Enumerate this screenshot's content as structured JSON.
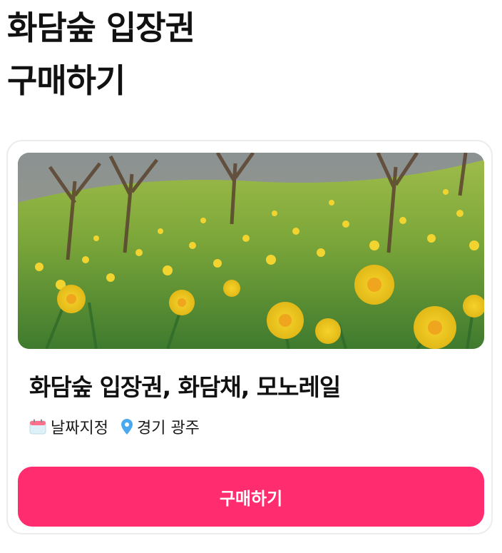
{
  "page": {
    "title": "화담숲 입장권\n구매하기"
  },
  "product": {
    "image_alt": "노란 수선화가 핀 화담숲 언덕",
    "title": "화담숲 입장권, 화담채, 모노레일",
    "date_label": "날짜지정",
    "date_icon": "calendar-icon",
    "location_label": "경기 광주",
    "location_icon": "location-pin-icon"
  },
  "actions": {
    "buy_label": "구매하기"
  },
  "colors": {
    "accent": "#ff2d6f",
    "location_icon": "#4aa8ef",
    "calendar_icon": "#ff6f8c"
  }
}
